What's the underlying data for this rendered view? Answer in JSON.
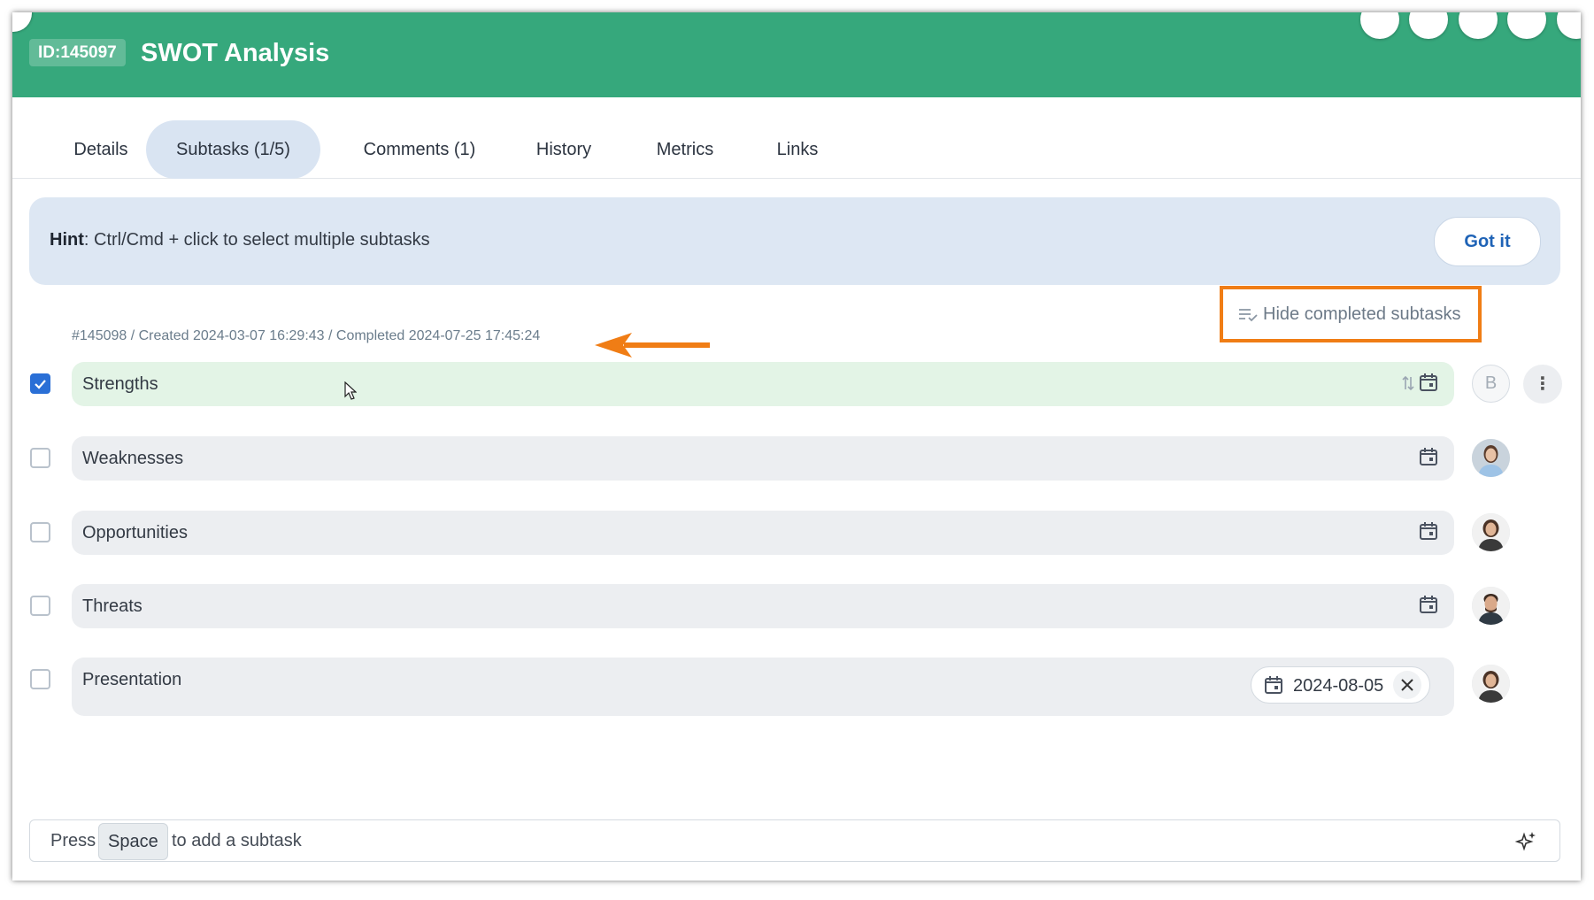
{
  "header": {
    "id_badge": "ID:145097",
    "title": "SWOT Analysis"
  },
  "tabs": [
    {
      "label": "Details"
    },
    {
      "label": "Subtasks (1/5)"
    },
    {
      "label": "Comments (1)"
    },
    {
      "label": "History"
    },
    {
      "label": "Metrics"
    },
    {
      "label": "Links"
    }
  ],
  "hint": {
    "label": "Hint",
    "text": ": Ctrl/Cmd + click to select multiple subtasks",
    "button": "Got it"
  },
  "hide_completed": {
    "label": "Hide completed subtasks"
  },
  "meta": {
    "text": "#145098 / Created 2024-03-07 16:29:43 / Completed 2024-07-25 17:45:24"
  },
  "subtasks": [
    {
      "name": "Strengths",
      "checked": true,
      "assignee_initial": "B"
    },
    {
      "name": "Weaknesses",
      "checked": false
    },
    {
      "name": "Opportunities",
      "checked": false
    },
    {
      "name": "Threats",
      "checked": false
    },
    {
      "name": "Presentation",
      "checked": false,
      "due_date": "2024-08-05"
    }
  ],
  "more_menu": "⋮",
  "add_bar": {
    "press": "Press",
    "key": "Space",
    "suffix": "to add a subtask"
  },
  "colors": {
    "header_bg": "#36a87c",
    "accent": "#2a6fd6",
    "highlight": "#f07d15",
    "done_row": "#e3f4e6"
  }
}
